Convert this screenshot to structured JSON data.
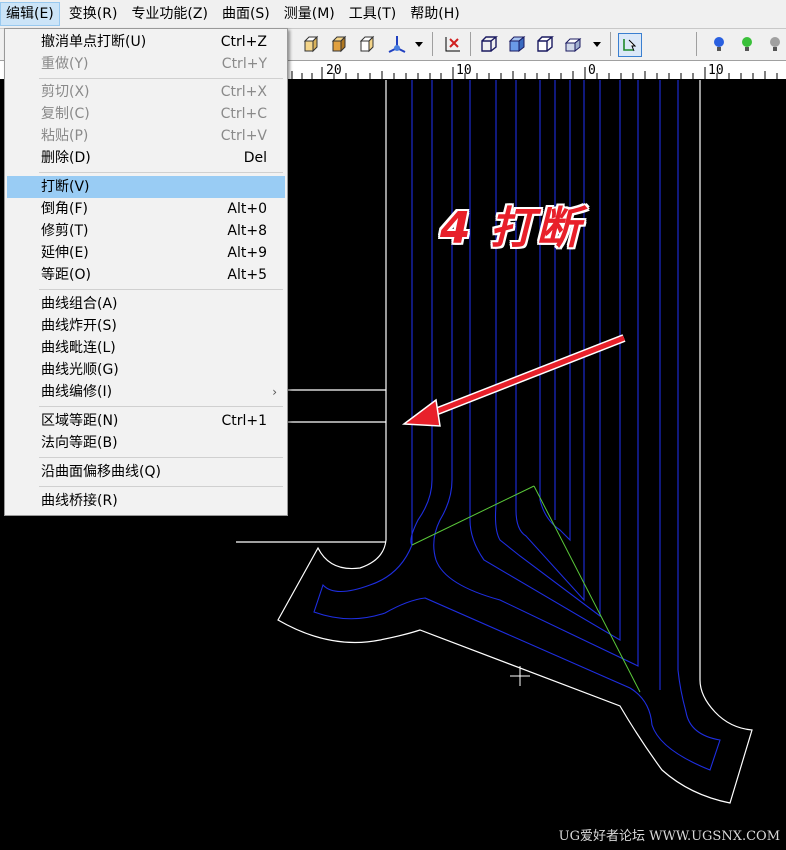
{
  "menubar": {
    "items": [
      {
        "label": "编辑(E)",
        "active": true
      },
      {
        "label": "变换(R)"
      },
      {
        "label": "专业功能(Z)"
      },
      {
        "label": "曲面(S)"
      },
      {
        "label": "测量(M)"
      },
      {
        "label": "工具(T)"
      },
      {
        "label": "帮助(H)"
      }
    ]
  },
  "edit_menu": {
    "undo": {
      "label": "撤消单点打断(U)",
      "shortcut": "Ctrl+Z"
    },
    "redo": {
      "label": "重做(Y)",
      "shortcut": "Ctrl+Y"
    },
    "cut": {
      "label": "剪切(X)",
      "shortcut": "Ctrl+X"
    },
    "copy": {
      "label": "复制(C)",
      "shortcut": "Ctrl+C"
    },
    "paste": {
      "label": "粘贴(P)",
      "shortcut": "Ctrl+V"
    },
    "delete": {
      "label": "删除(D)",
      "shortcut": "Del"
    },
    "break": {
      "label": "打断(V)",
      "shortcut": ""
    },
    "chamfer": {
      "label": "倒角(F)",
      "shortcut": "Alt+0"
    },
    "trim": {
      "label": "修剪(T)",
      "shortcut": "Alt+8"
    },
    "extend": {
      "label": "延伸(E)",
      "shortcut": "Alt+9"
    },
    "offset": {
      "label": "等距(O)",
      "shortcut": "Alt+5"
    },
    "curve_combine": {
      "label": "曲线组合(A)"
    },
    "curve_explode": {
      "label": "曲线炸开(S)"
    },
    "curve_join": {
      "label": "曲线毗连(L)"
    },
    "curve_smooth": {
      "label": "曲线光顺(G)"
    },
    "curve_edit": {
      "label": "曲线编修(I)",
      "submenu_arrow": "›"
    },
    "region_offset": {
      "label": "区域等距(N)",
      "shortcut": "Ctrl+1"
    },
    "normal_offset": {
      "label": "法向等距(B)"
    },
    "surface_offset_curve": {
      "label": "沿曲面偏移曲线(Q)"
    },
    "curve_bridge": {
      "label": "曲线桥接(R)"
    }
  },
  "ruler": {
    "labels": [
      "20",
      "10",
      "0",
      "10"
    ]
  },
  "annotation": {
    "text": "4 打断",
    "color": "#e8202a"
  },
  "watermark": "UG爱好者论坛 WWW.UGSNX.COM",
  "colors": {
    "menu_highlight": "#99ccf4",
    "curve_blue": "#1e2ee0",
    "curve_green": "#5ac83a",
    "outline_white": "#ffffff"
  }
}
